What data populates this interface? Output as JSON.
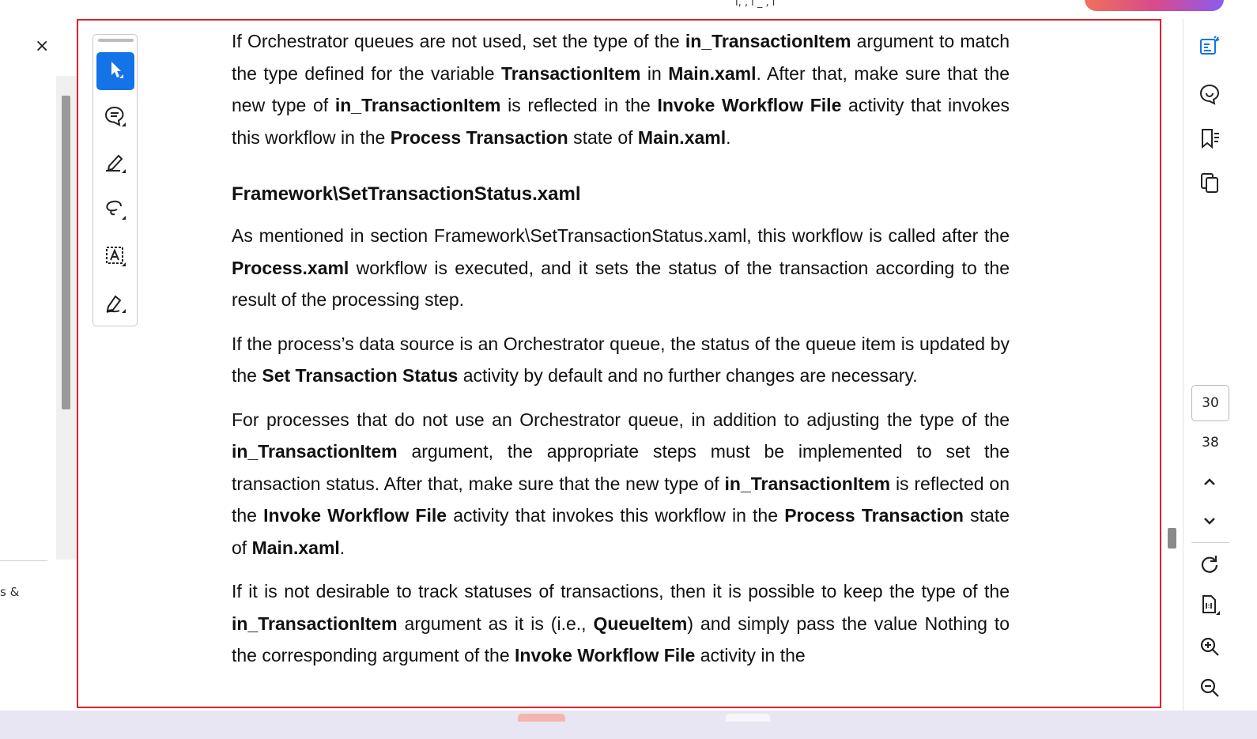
{
  "top": {
    "fragment": "ı,   ,   ı _  ,  ı    "
  },
  "left_panel": {
    "close_glyph": "×",
    "fragment": "s &"
  },
  "toolbar": {
    "tools": [
      {
        "name": "select-tool",
        "icon": "cursor-icon"
      },
      {
        "name": "comment-tool",
        "icon": "comment-icon"
      },
      {
        "name": "highlight-tool",
        "icon": "pen-icon"
      },
      {
        "name": "draw-tool",
        "icon": "lasso-icon"
      },
      {
        "name": "text-tool",
        "icon": "text-box-icon"
      },
      {
        "name": "sign-tool",
        "icon": "signature-icon"
      }
    ]
  },
  "document": {
    "p1": [
      {
        "t": "If Orchestrator queues are not used, set the type of the "
      },
      {
        "t": "in_TransactionItem",
        "b": true
      },
      {
        "t": " argument to match the type defined for the variable "
      },
      {
        "t": "TransactionItem",
        "b": true
      },
      {
        "t": " in "
      },
      {
        "t": "Main.xaml",
        "b": true
      },
      {
        "t": ". After that, make sure that the new type of "
      },
      {
        "t": "in_TransactionItem",
        "b": true
      },
      {
        "t": " is reflected in the "
      },
      {
        "t": "Invoke Workflow File",
        "b": true
      },
      {
        "t": " activity that invokes this workflow in the "
      },
      {
        "t": "Process Transaction",
        "b": true
      },
      {
        "t": " state of "
      },
      {
        "t": "Main.xaml",
        "b": true
      },
      {
        "t": "."
      }
    ],
    "heading": "Framework\\SetTransactionStatus.xaml",
    "p2": [
      {
        "t": "As mentioned in section Framework\\SetTransactionStatus.xaml, this workflow is called after the "
      },
      {
        "t": "Process.xaml",
        "b": true
      },
      {
        "t": " workflow is executed, and it sets the status of the transaction according to the result of the processing step."
      }
    ],
    "p3": [
      {
        "t": "If the process’s data source is an Orchestrator queue, the status of the queue item is updated by the "
      },
      {
        "t": "Set Transaction Status",
        "b": true
      },
      {
        "t": " activity by default and no further changes are necessary."
      }
    ],
    "p4": [
      {
        "t": "For processes that do not use an Orchestrator queue, in addition to adjusting the type of the "
      },
      {
        "t": "in_TransactionItem",
        "b": true
      },
      {
        "t": " argument, the appropriate steps must be implemented to set the transaction status. After that, make sure that the new type of "
      },
      {
        "t": "in_TransactionItem",
        "b": true
      },
      {
        "t": " is reflected on the "
      },
      {
        "t": "Invoke Workflow File",
        "b": true
      },
      {
        "t": " activity that invokes this workflow in the "
      },
      {
        "t": "Process Transaction",
        "b": true
      },
      {
        "t": " state of "
      },
      {
        "t": "Main.xaml",
        "b": true
      },
      {
        "t": "."
      }
    ],
    "p5": [
      {
        "t": "If it is not desirable to track statuses of transactions, then it is possible to keep the type of the "
      },
      {
        "t": "in_TransactionItem",
        "b": true
      },
      {
        "t": " argument as it is (i.e., "
      },
      {
        "t": "QueueItem",
        "b": true
      },
      {
        "t": ") and simply pass the value Nothing to the corresponding argument of the "
      },
      {
        "t": "Invoke Workflow File",
        "b": true
      },
      {
        "t": " activity in the"
      }
    ]
  },
  "right_rail": {
    "tools": [
      "edit-pdf-icon",
      "comment-rail-icon",
      "bookmark-icon",
      "pages-icon"
    ],
    "page_current": "30",
    "page_total": "38",
    "nav": [
      "chevron-up-icon",
      "chevron-down-icon",
      "rotate-icon",
      "actual-size-icon",
      "zoom-in-icon",
      "zoom-out-icon"
    ]
  },
  "colors": {
    "accent": "#1473e6",
    "frame": "#e0212f",
    "rail_icon": "#1473e6"
  }
}
